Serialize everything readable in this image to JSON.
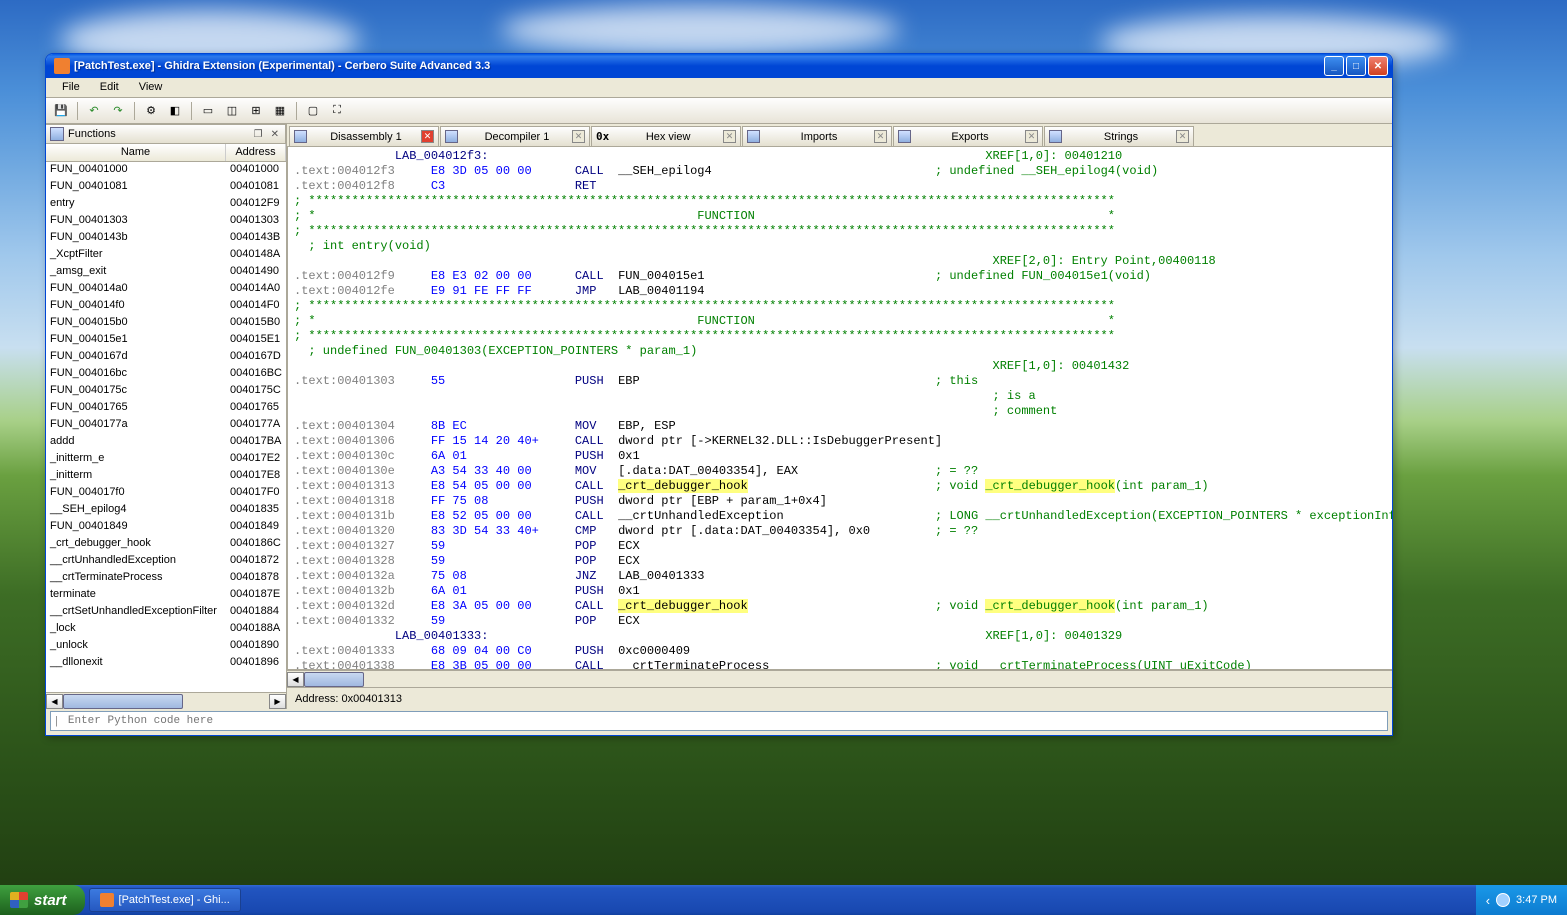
{
  "window": {
    "title": "[PatchTest.exe] - Ghidra Extension (Experimental) - Cerbero Suite Advanced 3.3"
  },
  "menu": {
    "file": "File",
    "edit": "Edit",
    "view": "View"
  },
  "panel_functions": {
    "title": "Functions",
    "col_name": "Name",
    "col_addr": "Address"
  },
  "functions": [
    {
      "name": "FUN_00401000",
      "addr": "00401000"
    },
    {
      "name": "FUN_00401081",
      "addr": "00401081"
    },
    {
      "name": "entry",
      "addr": "004012F9"
    },
    {
      "name": "FUN_00401303",
      "addr": "00401303"
    },
    {
      "name": "FUN_0040143b",
      "addr": "0040143B"
    },
    {
      "name": "_XcptFilter",
      "addr": "0040148A"
    },
    {
      "name": "_amsg_exit",
      "addr": "00401490"
    },
    {
      "name": "FUN_004014a0",
      "addr": "004014A0"
    },
    {
      "name": "FUN_004014f0",
      "addr": "004014F0"
    },
    {
      "name": "FUN_004015b0",
      "addr": "004015B0"
    },
    {
      "name": "FUN_004015e1",
      "addr": "004015E1"
    },
    {
      "name": "FUN_0040167d",
      "addr": "0040167D"
    },
    {
      "name": "FUN_004016bc",
      "addr": "004016BC"
    },
    {
      "name": "FUN_0040175c",
      "addr": "0040175C"
    },
    {
      "name": "FUN_00401765",
      "addr": "00401765"
    },
    {
      "name": "FUN_0040177a",
      "addr": "0040177A"
    },
    {
      "name": "addd",
      "addr": "004017BA"
    },
    {
      "name": "_initterm_e",
      "addr": "004017E2"
    },
    {
      "name": "_initterm",
      "addr": "004017E8"
    },
    {
      "name": "FUN_004017f0",
      "addr": "004017F0"
    },
    {
      "name": "__SEH_epilog4",
      "addr": "00401835"
    },
    {
      "name": "FUN_00401849",
      "addr": "00401849"
    },
    {
      "name": "_crt_debugger_hook",
      "addr": "0040186C"
    },
    {
      "name": "__crtUnhandledException",
      "addr": "00401872"
    },
    {
      "name": "__crtTerminateProcess",
      "addr": "00401878"
    },
    {
      "name": "terminate",
      "addr": "0040187E"
    },
    {
      "name": "__crtSetUnhandledExceptionFilter",
      "addr": "00401884"
    },
    {
      "name": "_lock",
      "addr": "0040188A"
    },
    {
      "name": "_unlock",
      "addr": "00401890"
    },
    {
      "name": "__dllonexit",
      "addr": "00401896"
    }
  ],
  "tabs": {
    "disassembly": "Disassembly 1",
    "decompiler": "Decompiler 1",
    "hexview": "Hex view",
    "hexprefix": "0x",
    "imports": "Imports",
    "exports": "Exports",
    "strings": "Strings"
  },
  "disasm": {
    "lines": [
      {
        "raw": "              LAB_004012f3:                                                                     XREF[1,0]: 00401210",
        "cls": "label-xref"
      },
      {
        "addr": ".text:004012f3",
        "hex": "E8 3D 05 00 00",
        "mnem": "CALL",
        "op": "__SEH_epilog4",
        "cmt": "; undefined __SEH_epilog4(void)"
      },
      {
        "addr": ".text:004012f8",
        "hex": "C3",
        "mnem": "RET",
        "op": "",
        "cmt": ""
      },
      {
        "sep": "; ****************************************************************************************************************"
      },
      {
        "sep": "; *                                                     FUNCTION                                                 *"
      },
      {
        "sep": "; ****************************************************************************************************************"
      },
      {
        "sep": "  ; int entry(void)"
      },
      {
        "raw": "                                                                                                 XREF[2,0]: Entry Point,00400118",
        "cls": "xref-only"
      },
      {
        "addr": ".text:004012f9",
        "hex": "E8 E3 02 00 00",
        "mnem": "CALL",
        "op": "FUN_004015e1",
        "cmt": "; undefined FUN_004015e1(void)"
      },
      {
        "addr": ".text:004012fe",
        "hex": "E9 91 FE FF FF",
        "mnem": "JMP",
        "op": "LAB_00401194",
        "cmt": ""
      },
      {
        "sep": "; ****************************************************************************************************************"
      },
      {
        "sep": "; *                                                     FUNCTION                                                 *"
      },
      {
        "sep": "; ****************************************************************************************************************"
      },
      {
        "sep": "  ; undefined FUN_00401303(EXCEPTION_POINTERS * param_1)"
      },
      {
        "raw": "                                                                                                 XREF[1,0]: 00401432",
        "cls": "xref-only"
      },
      {
        "addr": ".text:00401303",
        "hex": "55",
        "mnem": "PUSH",
        "op": "EBP",
        "cmt": "; this"
      },
      {
        "raw": "                                                                                                 ; is a",
        "cls": "cmt-only"
      },
      {
        "raw": "                                                                                                 ; comment",
        "cls": "cmt-only"
      },
      {
        "addr": ".text:00401304",
        "hex": "8B EC",
        "mnem": "MOV",
        "op": "EBP, ESP",
        "cmt": ""
      },
      {
        "addr": ".text:00401306",
        "hex": "FF 15 14 20 40+",
        "mnem": "CALL",
        "op": "dword ptr [->KERNEL32.DLL::IsDebuggerPresent]",
        "cmt": ""
      },
      {
        "addr": ".text:0040130c",
        "hex": "6A 01",
        "mnem": "PUSH",
        "op": "0x1",
        "cmt": ""
      },
      {
        "addr": ".text:0040130e",
        "hex": "A3 54 33 40 00",
        "mnem": "MOV",
        "op": "[.data:DAT_00403354], EAX",
        "cmt": "; = ??"
      },
      {
        "addr": ".text:00401313",
        "hex": "E8 54 05 00 00",
        "mnem": "CALL",
        "op": "_crt_debugger_hook",
        "cmt": "; void _crt_debugger_hook(int param_1)",
        "hl": true,
        "cmthl": "_crt_debugger_hook"
      },
      {
        "addr": ".text:00401318",
        "hex": "FF 75 08",
        "mnem": "PUSH",
        "op": "dword ptr [EBP + param_1+0x4]",
        "cmt": ""
      },
      {
        "addr": ".text:0040131b",
        "hex": "E8 52 05 00 00",
        "mnem": "CALL",
        "op": "__crtUnhandledException",
        "cmt": "; LONG __crtUnhandledException(EXCEPTION_POINTERS * exceptionInfo)"
      },
      {
        "addr": ".text:00401320",
        "hex": "83 3D 54 33 40+",
        "mnem": "CMP",
        "op": "dword ptr [.data:DAT_00403354], 0x0",
        "cmt": "; = ??"
      },
      {
        "addr": ".text:00401327",
        "hex": "59",
        "mnem": "POP",
        "op": "ECX",
        "cmt": ""
      },
      {
        "addr": ".text:00401328",
        "hex": "59",
        "mnem": "POP",
        "op": "ECX",
        "cmt": ""
      },
      {
        "addr": ".text:0040132a",
        "hex": "75 08",
        "mnem": "JNZ",
        "op": "LAB_00401333",
        "cmt": ""
      },
      {
        "addr": ".text:0040132b",
        "hex": "6A 01",
        "mnem": "PUSH",
        "op": "0x1",
        "cmt": ""
      },
      {
        "addr": ".text:0040132d",
        "hex": "E8 3A 05 00 00",
        "mnem": "CALL",
        "op": "_crt_debugger_hook",
        "cmt": "; void _crt_debugger_hook(int param_1)",
        "hl": true,
        "cmthl": "_crt_debugger_hook"
      },
      {
        "addr": ".text:00401332",
        "hex": "59",
        "mnem": "POP",
        "op": "ECX",
        "cmt": ""
      },
      {
        "raw": "              LAB_00401333:                                                                     XREF[1,0]: 00401329",
        "cls": "label-xref"
      },
      {
        "addr": ".text:00401333",
        "hex": "68 09 04 00 C0",
        "mnem": "PUSH",
        "op": "0xc0000409",
        "cmt": ""
      },
      {
        "addr": ".text:00401338",
        "hex": "E8 3B 05 00 00",
        "mnem": "CALL",
        "op": "__crtTerminateProcess",
        "cmt": "; void __crtTerminateProcess(UINT uExitCode)"
      }
    ]
  },
  "status": {
    "address": "Address: 0x00401313"
  },
  "python": {
    "placeholder": "Enter Python code here"
  },
  "taskbar": {
    "start": "start",
    "task": "[PatchTest.exe] - Ghi...",
    "clock": "3:47 PM"
  }
}
